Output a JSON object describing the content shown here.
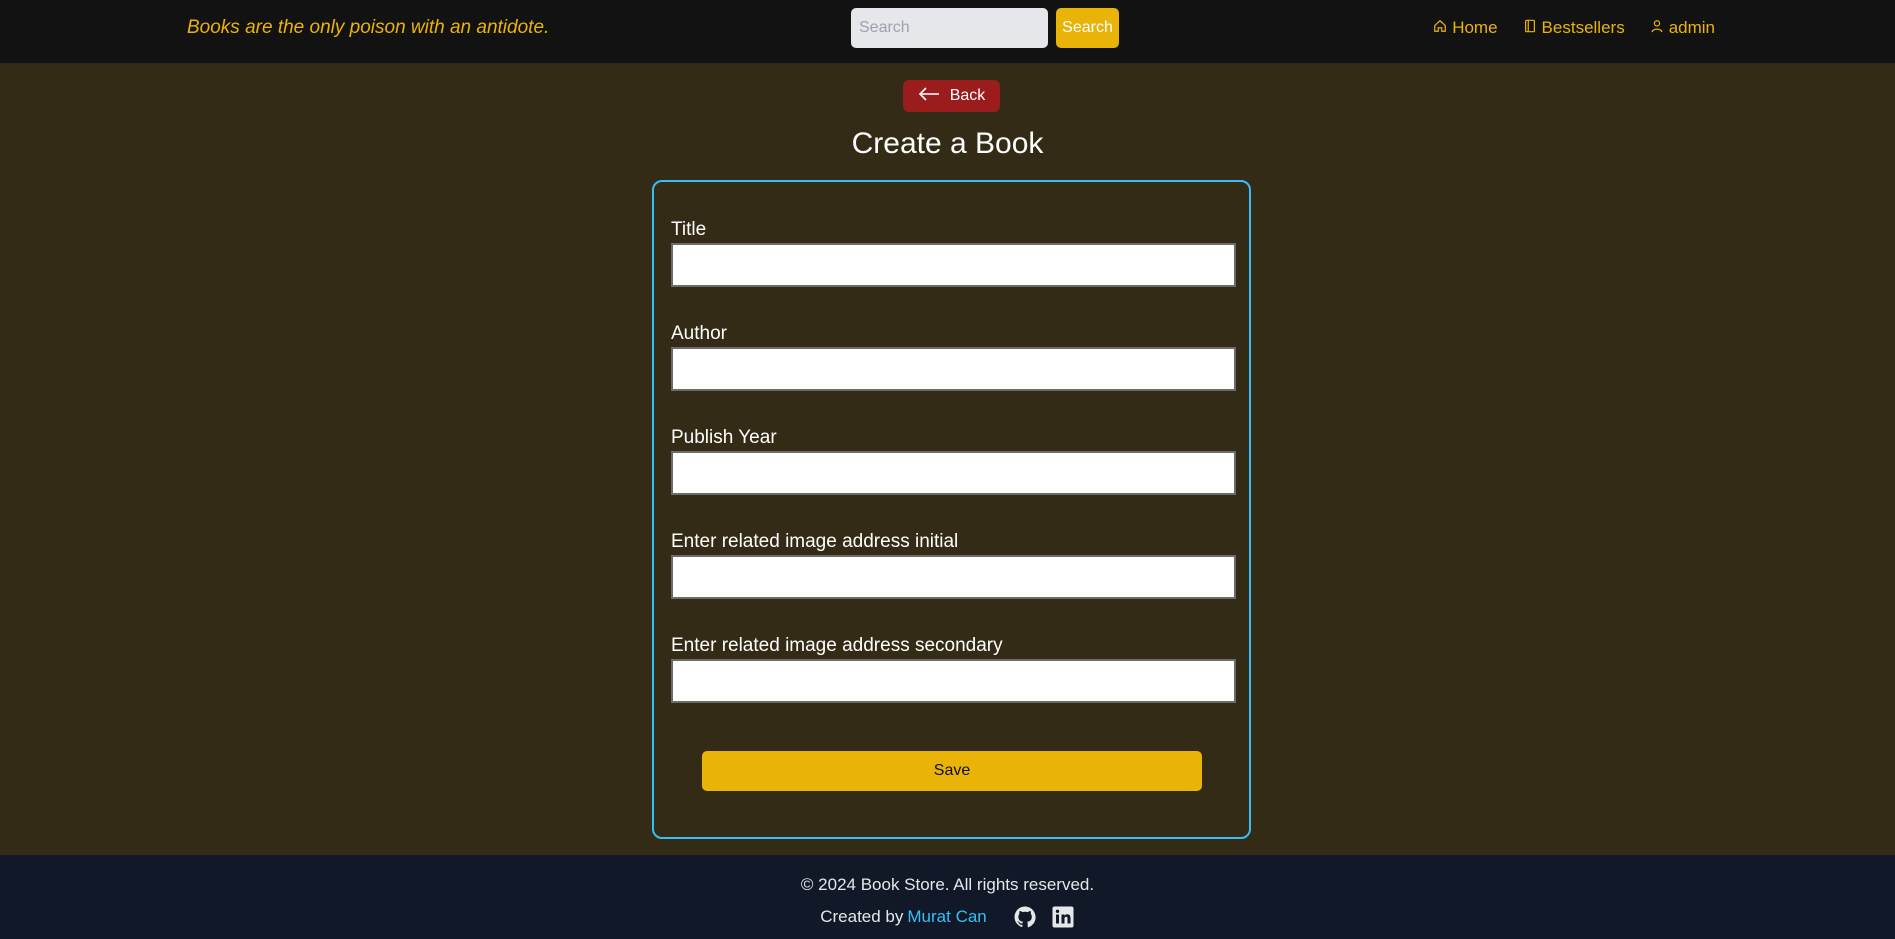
{
  "header": {
    "tagline": "Books are the only poison with an antidote.",
    "search_placeholder": "Search",
    "search_button": "Search",
    "nav": {
      "home": "Home",
      "bestsellers": "Bestsellers",
      "user": "admin"
    }
  },
  "main": {
    "back_label": "Back",
    "title": "Create a Book",
    "fields": [
      {
        "label": "Title",
        "value": ""
      },
      {
        "label": "Author",
        "value": ""
      },
      {
        "label": "Publish Year",
        "value": ""
      },
      {
        "label": "Enter related image address initial",
        "value": ""
      },
      {
        "label": "Enter related image address secondary",
        "value": ""
      }
    ],
    "save_label": "Save"
  },
  "footer": {
    "copyright": "© 2024 Book Store. All rights reserved.",
    "created_by": "Created by",
    "author_name": "Murat Can"
  },
  "colors": {
    "accent": "#eab308",
    "background": "#342b16",
    "header": "#121212",
    "footer": "#111827",
    "card_border": "#38bdf8",
    "back_button": "#9b1c1c",
    "link": "#38bdf8"
  },
  "icons": [
    "home-icon",
    "book-icon",
    "user-icon",
    "arrow-left-icon",
    "github-icon",
    "linkedin-icon"
  ]
}
